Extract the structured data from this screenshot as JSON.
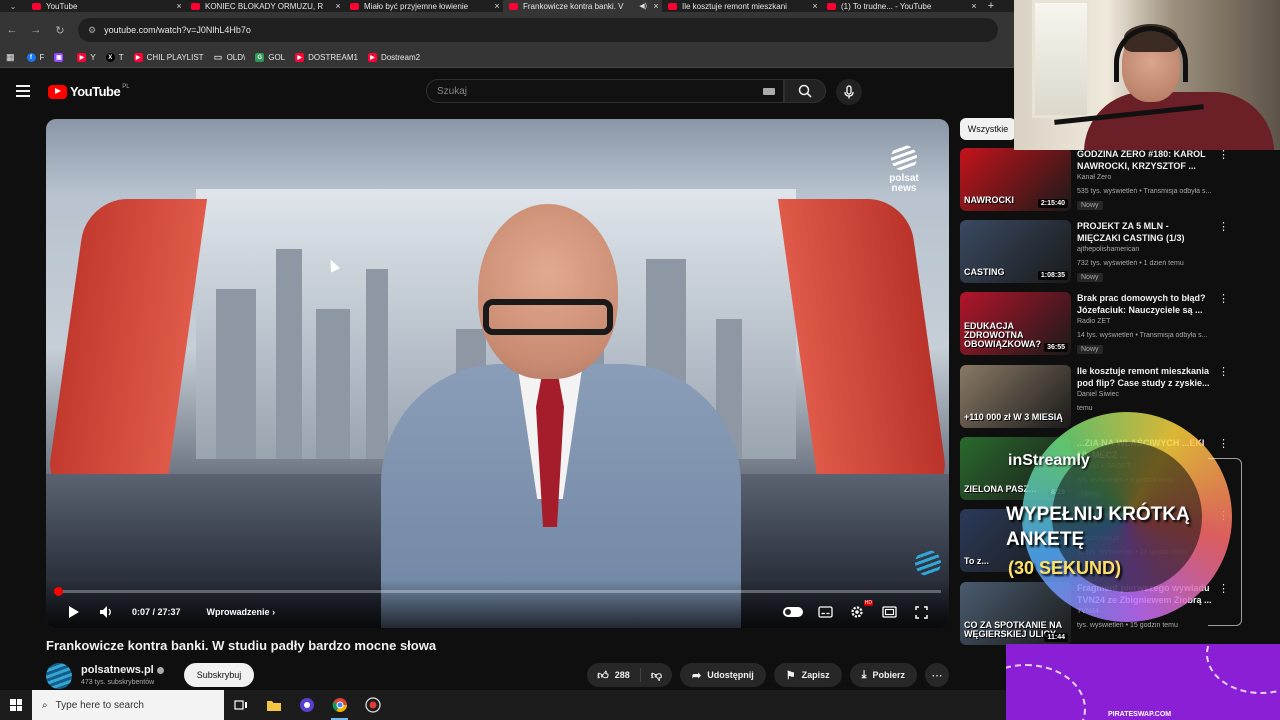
{
  "browser": {
    "tabs": [
      {
        "title": "YouTube",
        "active": false,
        "audio": false
      },
      {
        "title": "KONIEC BLOKADY ORMUZU, R",
        "active": false,
        "audio": false
      },
      {
        "title": "Miało być przyjemne łowienie",
        "active": false,
        "audio": false
      },
      {
        "title": "Frankowicze kontra banki. V",
        "active": true,
        "audio": true
      },
      {
        "title": "Ile kosztuje remont mieszkani",
        "active": false,
        "audio": false
      },
      {
        "title": "(1) To trudne... - YouTube",
        "active": false,
        "audio": false
      }
    ],
    "url": "youtube.com/watch?v=J0NlhL4Hb7o",
    "bookmarks": [
      {
        "label": "F",
        "color": "#1877f2",
        "glyph": "f"
      },
      {
        "label": "",
        "color": "#9146ff",
        "glyph": "▣"
      },
      {
        "label": "Y",
        "color": "#ff0033",
        "glyph": "▶"
      },
      {
        "label": "T",
        "color": "#000000",
        "glyph": "X"
      },
      {
        "label": "CHIL PLAYLIST",
        "color": "#ff0033",
        "glyph": "▶"
      },
      {
        "label": "OLD\\",
        "color": "transparent",
        "glyph": "▭"
      },
      {
        "label": "GOL",
        "color": "#2e9a57",
        "glyph": "G"
      },
      {
        "label": "DOSTREAM1",
        "color": "#ff0033",
        "glyph": "▶"
      },
      {
        "label": "Dostream2",
        "color": "#ff0033",
        "glyph": "▶"
      }
    ]
  },
  "youtube": {
    "logo_text": "YouTube",
    "country_code": "PL",
    "search_placeholder": "Szukaj",
    "video": {
      "watermark": "polsat news",
      "current_time": "0:07 / 27:37",
      "chapter": "Wprowadzenie",
      "progress": 0.004
    },
    "title": "Frankowicze kontra banki. W studiu padły bardzo mocne słowa",
    "channel": {
      "name": "polsatnews.pl",
      "subscribers": "473 tys. subskrybentów",
      "subscribe_label": "Subskrybuj"
    },
    "actions": {
      "likes": "288",
      "share": "Udostępnij",
      "save": "Zapisz",
      "download": "Pobierz"
    },
    "chip_label": "Wszystkie",
    "recommendations": [
      {
        "title": "GODZINA ZERO #180: KAROL NAWROCKI, KRZYSZTOF ...",
        "channel": "Kanał Zero",
        "meta": "535 tys. wyświetleń • Transmisja odbyła s...",
        "badge": "Nowy",
        "duration": "2:15:40",
        "thumb_text": "NAWROCKI",
        "thumb_color": "#c5131b"
      },
      {
        "title": "PROJEKT ZA 5 MLN - MIĘCZAKI CASTING (1/3)",
        "channel": "ajthepolishamerican",
        "meta": "732 tys. wyświetleń • 1 dzień temu",
        "badge": "Nowy",
        "duration": "1:08:35",
        "thumb_text": "CASTING",
        "thumb_color": "#3a4a63"
      },
      {
        "title": "Brak prac domowych to błąd? Józefaciuk: Nauczyciele są ...",
        "channel": "Radio ZET",
        "meta": "14 tys. wyświetleń • Transmisja odbyła s...",
        "badge": "Nowy",
        "duration": "36:55",
        "thumb_text": "EDUKACJA ZDROWOTNA OBOWIĄZKOWA?",
        "thumb_color": "#b3152b"
      },
      {
        "title": "Ile kosztuje remont mieszkania pod flip? Case study z zyskie...",
        "channel": "Daniel Siwiec",
        "meta": "temu",
        "badge": "",
        "duration": "",
        "thumb_text": "+110 000 zł W 3 MIESIĄ",
        "thumb_color": "#8a7a66"
      },
      {
        "title": "...ZIA NA WŁAŚCIWYCH ...EKI 10. MECZ ...",
        "channel": "CANAL+ SPORT",
        "meta": "tys. wyświetleń • 9 godzin temu",
        "badge": "Nowy",
        "duration": "8:29",
        "thumb_text": "ZIELONA PASZ...",
        "thumb_color": "#2a6a2d"
      },
      {
        "title": "...członkowsko w Unii ...",
        "channel": "polsatnews.pl",
        "meta": "18 tys. wyświetleń • 13 godzin temu",
        "badge": "",
        "duration": "",
        "thumb_text": "To z...",
        "thumb_color": "#2b3a5a"
      },
      {
        "title": "Fragment pierwszego wywiadu TVN24 ze Zbigniewem Ziobrą ...",
        "channel": "TVN24",
        "meta": "tys. wyświetleń • 15 godzin temu",
        "badge": "",
        "duration": "11:44",
        "thumb_text": "CO ZA SPOTKANIE NA WĘGIERSKIEJ ULICY",
        "thumb_color": "#4a5c70"
      }
    ]
  },
  "overlay": {
    "brand": "inStreamly",
    "line1": "WYPEŁNIJ KRÓTKĄ",
    "line2": "ANKETĘ",
    "line3": "(30 SEKUND)",
    "site": "PIRATESWAP.COM"
  },
  "taskbar": {
    "search_placeholder": "Type here to search"
  }
}
